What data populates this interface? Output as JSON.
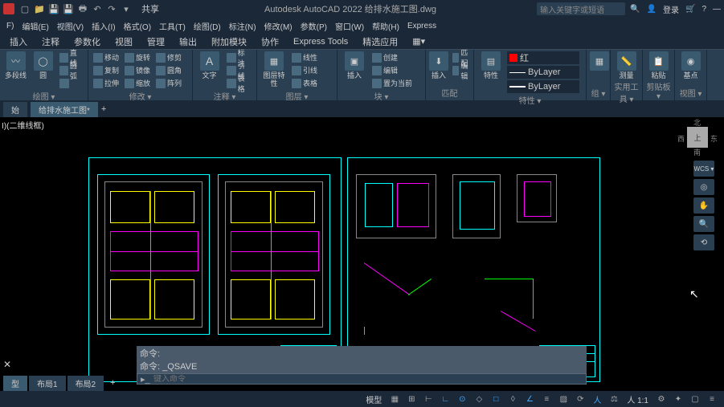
{
  "title": "Autodesk AutoCAD 2022  给排水施工图.dwg",
  "share": "共享",
  "search_placeholder": "输入关键字或短语",
  "login": "登录",
  "menus": [
    "F)",
    "编辑(E)",
    "视图(V)",
    "插入(I)",
    "格式(O)",
    "工具(T)",
    "绘图(D)",
    "标注(N)",
    "修改(M)",
    "参数(P)",
    "窗口(W)",
    "帮助(H)",
    "Express"
  ],
  "tabs": [
    "插入",
    "注释",
    "参数化",
    "视图",
    "管理",
    "输出",
    "附加模块",
    "协作",
    "Express Tools",
    "精选应用"
  ],
  "panel": {
    "draw": {
      "label": "绘图 ▾",
      "big1": "多段线",
      "big2": "圆",
      "items": [
        "直线",
        "圆弧"
      ]
    },
    "modify": {
      "label": "修改 ▾",
      "items": [
        "移动",
        "旋转",
        "修剪",
        "复制",
        "镜像",
        "圆角",
        "拉伸",
        "缩放",
        "阵列"
      ]
    },
    "annot": {
      "label": "注释 ▾",
      "big": "文字",
      "items": [
        "标注",
        "引线",
        "表格"
      ]
    },
    "layers": {
      "label": "图层 ▾",
      "big": "图层特性",
      "items": [
        "线性",
        "引线",
        "表格"
      ]
    },
    "block": {
      "label": "块 ▾",
      "big": "插入",
      "items": [
        "创建",
        "编辑",
        "置为当前",
        "编辑属性",
        "匹配图层"
      ]
    },
    "prop": {
      "label": "特性 ▾",
      "big": "特性",
      "color": "红",
      "l1": "ByLayer",
      "l2": "ByLayer",
      "items": [
        "匹配",
        "编辑"
      ]
    },
    "group": {
      "label": "组 ▾"
    },
    "util": {
      "label": "实用工具 ▾",
      "big": "测量"
    },
    "clip": {
      "label": "剪贴板 ▾",
      "big": "粘贴"
    },
    "view": {
      "label": "视图 ▾",
      "big": "基点"
    }
  },
  "filetabs": {
    "t1": "始",
    "t2": "给排水施工图*"
  },
  "canvas_label": "I)(二维线框)",
  "viewcube": {
    "top": "上",
    "n": "北",
    "s": "南",
    "w": "西",
    "e": "东",
    "wcs": "WCS ▾"
  },
  "cmd": {
    "hist1": "命令:",
    "hist2": "命令:  _QSAVE",
    "prompt": "键入命令"
  },
  "layouts": {
    "model": "型",
    "l1": "布局1",
    "l2": "布局2"
  },
  "status": {
    "model": "模型"
  }
}
